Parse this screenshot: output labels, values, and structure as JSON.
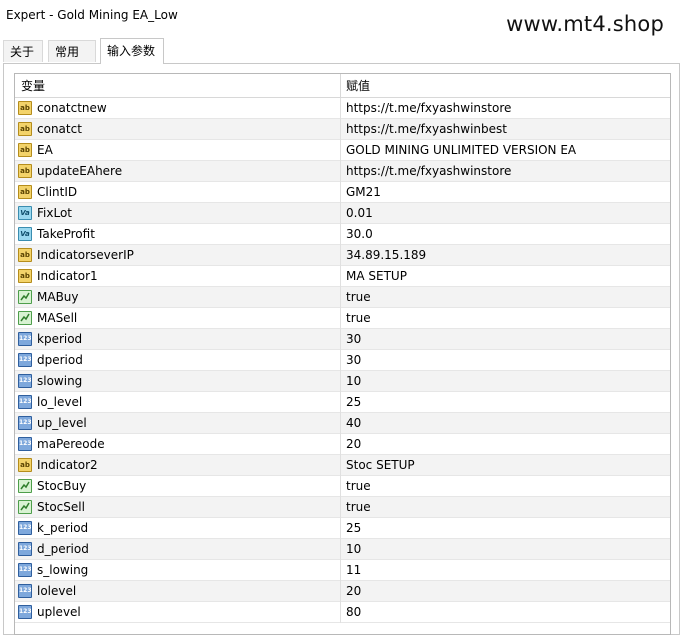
{
  "window": {
    "title": "Expert - Gold Mining EA_Low",
    "watermark": "www.mt4.shop"
  },
  "tabs": [
    {
      "label": "关于",
      "active": false
    },
    {
      "label": "常用",
      "active": false
    },
    {
      "label": "输入参数",
      "active": true
    }
  ],
  "table": {
    "headers": {
      "variable": "变量",
      "value": "赋值"
    },
    "rows": [
      {
        "type": "ab",
        "name": "conatctnew",
        "value": "https://t.me/fxyashwinstore"
      },
      {
        "type": "ab",
        "name": "conatct",
        "value": "https://t.me/fxyashwinbest"
      },
      {
        "type": "ab",
        "name": "EA",
        "value": "GOLD MINING UNLIMITED VERSION EA"
      },
      {
        "type": "ab",
        "name": "updateEAhere",
        "value": "https://t.me/fxyashwinstore"
      },
      {
        "type": "ab",
        "name": "ClintID",
        "value": "GM21"
      },
      {
        "type": "va",
        "name": "FixLot",
        "value": "0.01"
      },
      {
        "type": "va",
        "name": "TakeProfit",
        "value": "30.0"
      },
      {
        "type": "ab",
        "name": "IndicatorseverIP",
        "value": "34.89.15.189"
      },
      {
        "type": "ab",
        "name": "Indicator1",
        "value": "MA SETUP"
      },
      {
        "type": "bool",
        "name": "MABuy",
        "value": "true"
      },
      {
        "type": "bool",
        "name": "MASell",
        "value": "true"
      },
      {
        "type": "int",
        "name": "kperiod",
        "value": "30"
      },
      {
        "type": "int",
        "name": "dperiod",
        "value": "30"
      },
      {
        "type": "int",
        "name": "slowing",
        "value": "10"
      },
      {
        "type": "int",
        "name": "lo_level",
        "value": "25"
      },
      {
        "type": "int",
        "name": "up_level",
        "value": "40"
      },
      {
        "type": "int",
        "name": "maPereode",
        "value": "20"
      },
      {
        "type": "ab",
        "name": "Indicator2",
        "value": "Stoc SETUP"
      },
      {
        "type": "bool",
        "name": "StocBuy",
        "value": "true"
      },
      {
        "type": "bool",
        "name": "StocSell",
        "value": "true"
      },
      {
        "type": "int",
        "name": "k_period",
        "value": "25"
      },
      {
        "type": "int",
        "name": "d_period",
        "value": "10"
      },
      {
        "type": "int",
        "name": "s_lowing",
        "value": "11"
      },
      {
        "type": "int",
        "name": "lolevel",
        "value": "20"
      },
      {
        "type": "int",
        "name": "uplevel",
        "value": "80"
      }
    ]
  },
  "icons": {
    "ab": "string-type-icon",
    "va": "double-type-icon",
    "bool": "bool-type-icon",
    "int": "integer-type-icon"
  },
  "icon_glyphs": {
    "ab": "ab",
    "va": "Va",
    "int": "123"
  }
}
